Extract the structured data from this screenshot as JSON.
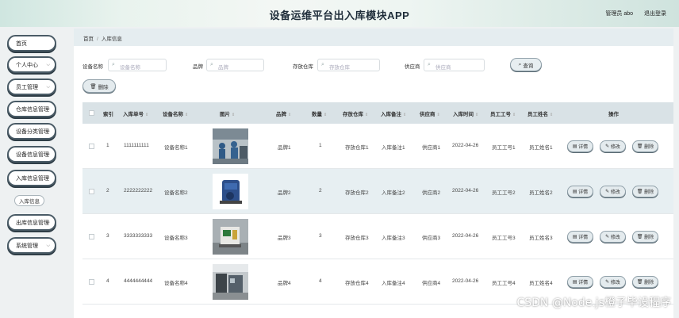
{
  "header": {
    "title": "设备运维平台出入库模块APP",
    "user": "管理员 abo",
    "logout": "退出登录"
  },
  "sidebar": {
    "items": [
      {
        "label": "首页",
        "chevron": false
      },
      {
        "label": "个人中心",
        "chevron": true
      },
      {
        "label": "员工管理",
        "chevron": true
      },
      {
        "label": "仓库信息管理",
        "chevron": true
      },
      {
        "label": "设备分类管理",
        "chevron": true
      },
      {
        "label": "设备信息管理",
        "chevron": true
      },
      {
        "label": "入库信息管理",
        "chevron": true
      },
      {
        "label": "出库信息管理",
        "chevron": true
      },
      {
        "label": "系统管理",
        "chevron": true
      }
    ],
    "sub_item": "入库信息"
  },
  "breadcrumb": {
    "home": "首页",
    "sep": "/",
    "current": "入库信息"
  },
  "search": {
    "device_name_label": "设备名称",
    "device_name_placeholder": "设备名称",
    "brand_label": "品牌",
    "brand_placeholder": "品牌",
    "warehouse_label": "存放仓库",
    "warehouse_placeholder": "存放仓库",
    "supplier_label": "供应商",
    "supplier_placeholder": "供应商",
    "query_button": "查询"
  },
  "delete_button": "删除",
  "table": {
    "headers": [
      "索引",
      "入库单号",
      "设备名称",
      "图片",
      "品牌",
      "数量",
      "存放仓库",
      "入库备注",
      "供应商",
      "入库时间",
      "员工工号",
      "员工姓名",
      "操作"
    ],
    "rows": [
      {
        "index": "1",
        "order_no": "1111111111",
        "device": "设备名称1",
        "brand": "品牌1",
        "qty": "1",
        "warehouse": "存放仓库1",
        "note": "入库备注1",
        "supplier": "供应商1",
        "time": "2022-04-26",
        "emp_no": "员工工号1",
        "emp_name": "员工姓名1"
      },
      {
        "index": "2",
        "order_no": "2222222222",
        "device": "设备名称2",
        "brand": "品牌2",
        "qty": "2",
        "warehouse": "存放仓库2",
        "note": "入库备注2",
        "supplier": "供应商2",
        "time": "2022-04-26",
        "emp_no": "员工工号2",
        "emp_name": "员工姓名2"
      },
      {
        "index": "3",
        "order_no": "3333333333",
        "device": "设备名称3",
        "brand": "品牌3",
        "qty": "3",
        "warehouse": "存放仓库3",
        "note": "入库备注3",
        "supplier": "供应商3",
        "time": "2022-04-26",
        "emp_no": "员工工号3",
        "emp_name": "员工姓名3"
      },
      {
        "index": "4",
        "order_no": "4444444444",
        "device": "设备名称4",
        "brand": "品牌4",
        "qty": "4",
        "warehouse": "存放仓库4",
        "note": "入库备注4",
        "supplier": "供应商4",
        "time": "2022-04-26",
        "emp_no": "员工工号4",
        "emp_name": "员工姓名4"
      }
    ],
    "actions": {
      "detail": "详情",
      "edit": "修改",
      "delete": "删除"
    }
  },
  "watermark": "CSDN @Node.js橙子毕设程序",
  "colors": {
    "accent": "#4a5b66",
    "row_alt": "#e7eff2",
    "header_bg": "#d9e2e6"
  }
}
